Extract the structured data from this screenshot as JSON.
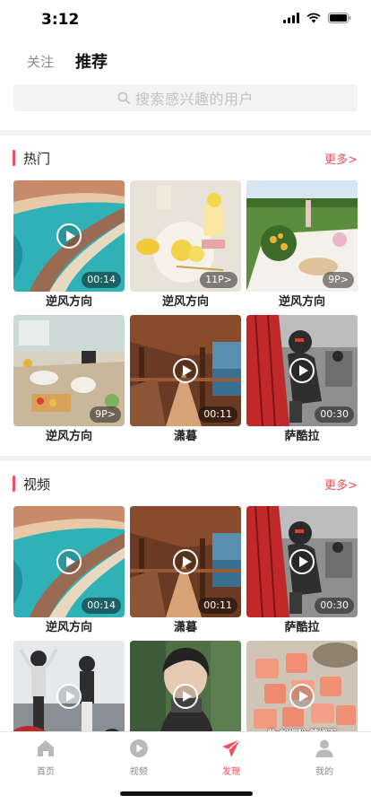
{
  "status": {
    "time": "3:12"
  },
  "header": {
    "tab_follow": "关注",
    "tab_recommend": "推荐"
  },
  "search": {
    "placeholder": "搜索感兴趣的用户"
  },
  "sections": {
    "hot": {
      "title": "热门",
      "more": "更多>",
      "items": [
        {
          "title": "逆风方向",
          "badge": "00:14",
          "type": "video",
          "image": "coast"
        },
        {
          "title": "逆风方向",
          "badge": "11P>",
          "type": "photos",
          "image": "lemons"
        },
        {
          "title": "逆风方向",
          "badge": "9P>",
          "type": "photos",
          "image": "picnic"
        },
        {
          "title": "逆风方向",
          "badge": "9P>",
          "type": "photos",
          "image": "food-table"
        },
        {
          "title": "潇暮",
          "badge": "00:11",
          "type": "video",
          "image": "pavilion"
        },
        {
          "title": "萨酷拉",
          "badge": "00:30",
          "type": "video",
          "image": "motorbike"
        }
      ]
    },
    "video": {
      "title": "视频",
      "more": "更多>",
      "items": [
        {
          "title": "逆风方向",
          "badge": "00:14",
          "type": "video",
          "image": "coast"
        },
        {
          "title": "潇暮",
          "badge": "00:11",
          "type": "video",
          "image": "pavilion"
        },
        {
          "title": "萨酷拉",
          "badge": "00:30",
          "type": "video",
          "image": "motorbike"
        },
        {
          "title": "",
          "badge": "",
          "type": "video",
          "image": "riders"
        },
        {
          "title": "",
          "badge": "",
          "type": "video",
          "image": "portrait"
        },
        {
          "title": "",
          "badge": "",
          "type": "video",
          "image": "salmon",
          "caption": "盐 胡椒粉 辣椒面"
        }
      ]
    }
  },
  "tabbar": {
    "items": [
      {
        "label": "首页",
        "icon": "home-icon",
        "active": false
      },
      {
        "label": "视频",
        "icon": "play-circle-icon",
        "active": false
      },
      {
        "label": "发现",
        "icon": "paper-plane-icon",
        "active": true
      },
      {
        "label": "我的",
        "icon": "user-icon",
        "active": false
      }
    ]
  },
  "colors": {
    "accent": "#f0505a",
    "inactive": "#888888",
    "divider": "#f2f2f2"
  }
}
